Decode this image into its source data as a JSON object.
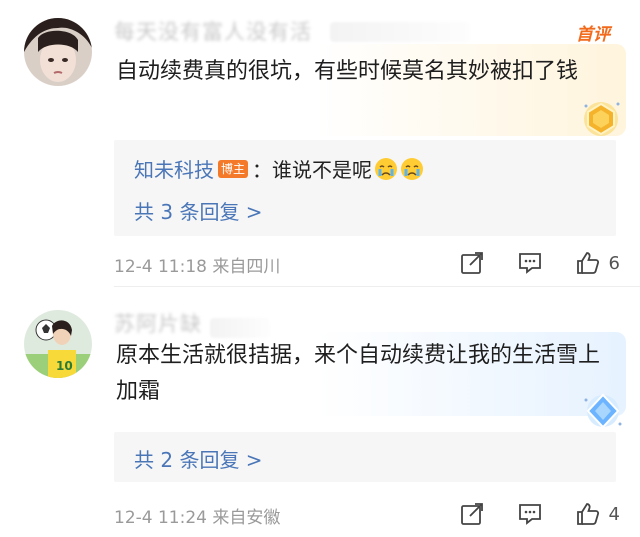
{
  "comments": [
    {
      "username": "每天没有富人没有活",
      "first_tag": "首评",
      "text": "自动续费真的很坑，有些时候莫名其妙被扣了钱",
      "reply": {
        "author": "知未科技",
        "host_tag": "博主",
        "text": "：谁说不是呢"
      },
      "more_replies": "共 3 条回复 >",
      "time": "12-4 11:18",
      "location": "来自四川",
      "likes": "6"
    },
    {
      "username": "苏阿片缺",
      "text": "原本生活就很拮据，来个自动续费让我的生活雪上加霜",
      "more_replies": "共 2 条回复 >",
      "time": "12-4 11:24",
      "location": "来自安徽",
      "likes": "4"
    }
  ],
  "colors": {
    "accent_blue": "#4a76b8",
    "first_tag_orange": "#f26b1d",
    "meta_gray": "#9a9a9a"
  },
  "icons": [
    "forward-icon",
    "comment-icon",
    "thumbs-up-icon",
    "crying-emoji-icon",
    "gold-medal-icon",
    "diamond-badge-icon"
  ]
}
